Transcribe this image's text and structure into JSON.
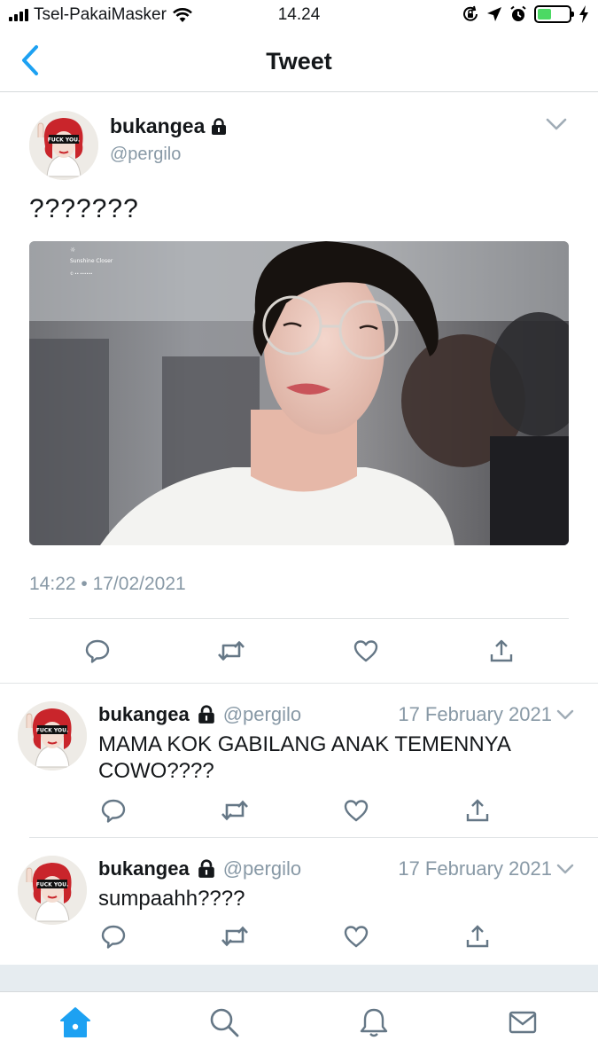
{
  "status_bar": {
    "carrier": "Tsel-PakaiMasker",
    "time": "14.24",
    "battery_level": 0.45
  },
  "header": {
    "title": "Tweet",
    "back_icon": "chevron-left-icon"
  },
  "tweet": {
    "display_name": "bukangea",
    "handle": "@pergilo",
    "protected": true,
    "text": "???????",
    "media_overlay": {
      "title": "Sunshine Closer",
      "subtitle": "© •• ••••••"
    },
    "timestamp": "14:22 • 17/02/2021",
    "actions": [
      "reply-icon",
      "retweet-icon",
      "like-icon",
      "share-icon"
    ]
  },
  "replies": [
    {
      "display_name": "bukangea",
      "handle": "@pergilo",
      "date": "17 February 2021",
      "text": "MAMA KOK GABILANG ANAK TEMENNYA COWO????"
    },
    {
      "display_name": "bukangea",
      "handle": "@pergilo",
      "date": "17 February 2021",
      "text": "sumpaahh????"
    }
  ],
  "avatar_caption": "FUCK YOU.",
  "tab_bar": [
    "home-icon",
    "search-icon",
    "notifications-icon",
    "messages-icon"
  ],
  "colors": {
    "accent": "#1da1f2",
    "secondary_text": "#8899a6",
    "divider": "#e1e4e6",
    "battery_green": "#4cd964"
  }
}
